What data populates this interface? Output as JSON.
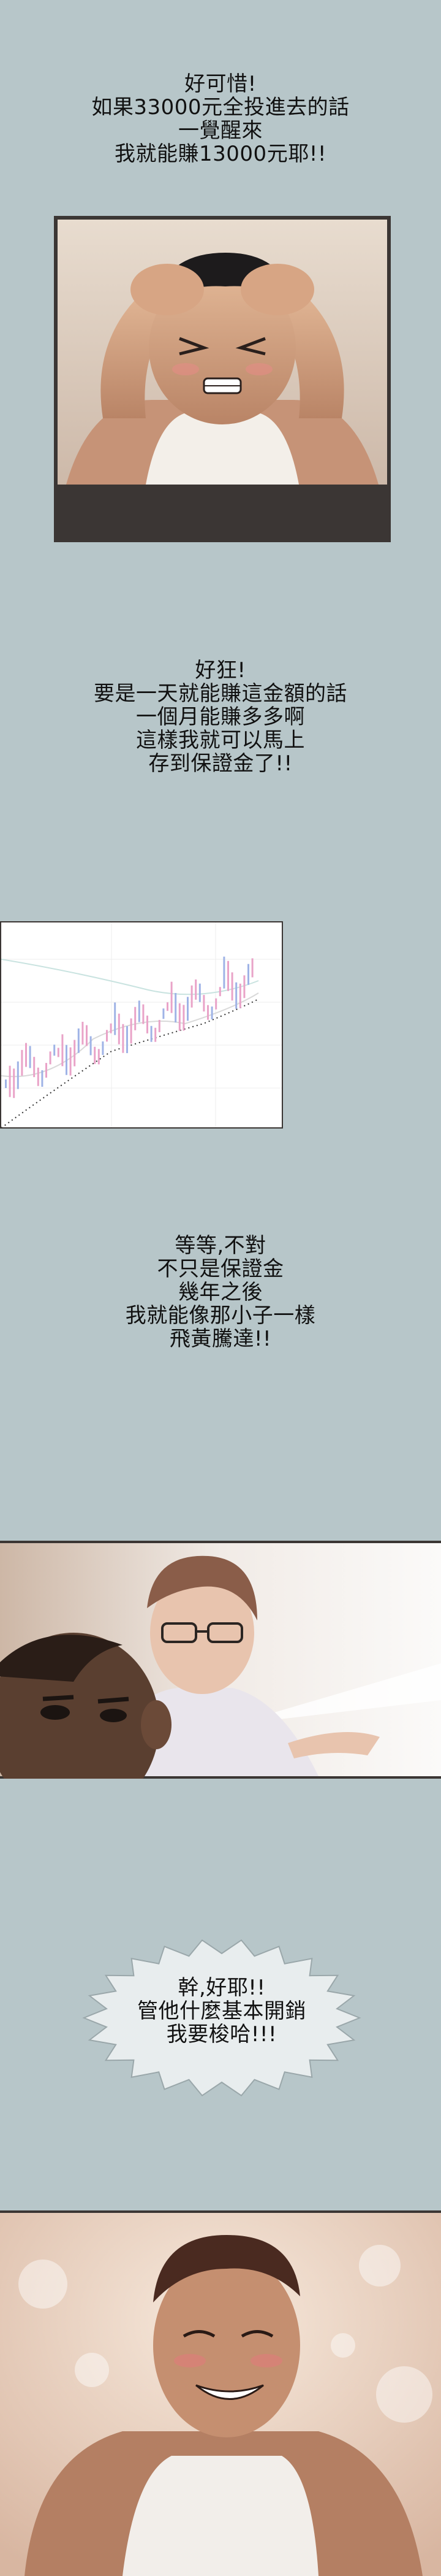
{
  "captions": {
    "c1": {
      "line1": "好可惜!",
      "line2": "如果33000元全投進去的話",
      "line3": "一覺醒來",
      "line4": "我就能賺13000元耶!!"
    },
    "c2": {
      "line1": "好狂!",
      "line2": "要是一天就能賺這金額的話",
      "line3": "一個月能賺多多啊",
      "line4": "這樣我就可以馬上",
      "line5": "存到保證金了!!"
    },
    "c3": {
      "line1": "等等,不對",
      "line2": "不只是保證金",
      "line3": "幾年之後",
      "line4": "我就能像那小子一樣",
      "line5": "飛黃騰達!!"
    },
    "c4": {
      "line1": "幹,好耶!!",
      "line2": "管他什麼基本開銷",
      "line3": "我要梭哈!!!"
    }
  },
  "colors": {
    "background": "#b7c6c9",
    "panel_frame": "#3b3634",
    "chart_bg": "#ffffff",
    "candle_pink": "#e9a3c8",
    "candle_blue": "#9fb3e6"
  }
}
